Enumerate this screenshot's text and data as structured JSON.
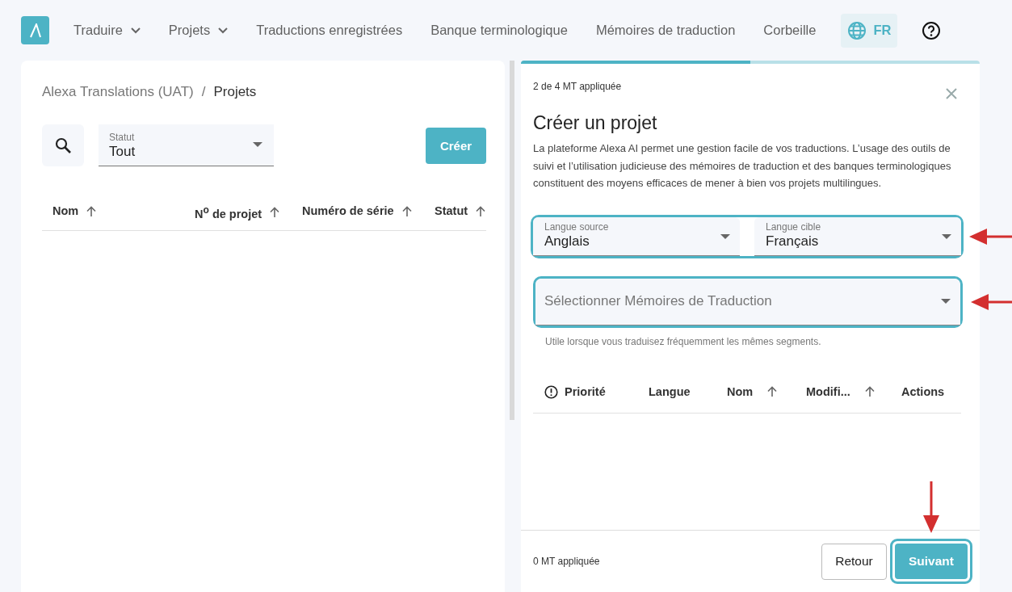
{
  "nav": {
    "items": [
      {
        "label": "Traduire",
        "dropdown": true
      },
      {
        "label": "Projets",
        "dropdown": true
      },
      {
        "label": "Traductions enregistrées",
        "dropdown": false
      },
      {
        "label": "Banque terminologique",
        "dropdown": false
      },
      {
        "label": "Mémoires de traduction",
        "dropdown": false
      },
      {
        "label": "Corbeille",
        "dropdown": false
      }
    ],
    "language": "FR"
  },
  "projects": {
    "breadcrumb": [
      {
        "label": "Alexa Translations (UAT)",
        "current": false
      },
      {
        "label": "Projets",
        "current": true
      }
    ],
    "separator": "/",
    "status_filter": {
      "label": "Statut",
      "value": "Tout"
    },
    "create_button": "Créer",
    "columns": [
      {
        "label": "Nom",
        "sortable": true
      },
      {
        "label": "N$^{o}$ de projet",
        "sortable": true
      },
      {
        "label": "Numéro de série",
        "sortable": true
      },
      {
        "label": "Statut",
        "sortable": true
      }
    ]
  },
  "create_panel": {
    "progress": {
      "level": 0.5
    },
    "step": "2 de 4 MT appliquée",
    "title": "Créer un projet",
    "description": "La plateforme Alexa AI permet une gestion facile de vos traductions. L’usage des outils de suivi et l’utilisation judicieuse des mémoires de traduction et des banques terminologiques constituent des moyens efficaces de mener à bien vos projets multilingues.",
    "source_language": {
      "label": "Langue source",
      "value": "Anglais"
    },
    "target_language": {
      "label": "Langue cible",
      "value": "Français"
    },
    "languages_highlighted": true,
    "memory_select": {
      "placeholder": "Sélectionner Mémoires de Traduction",
      "helper": "Utile lorsque vous traduisez fréquemment les mêmes segments.",
      "highlighted": true
    },
    "memory_columns": [
      {
        "label": "Priorité",
        "sortable": false,
        "alert_icon": true
      },
      {
        "label": "Langue",
        "sortable": false,
        "alert_icon": false
      },
      {
        "label": "Nom",
        "sortable": true,
        "alert_icon": false
      },
      {
        "label": "Modifi...",
        "sortable": true,
        "alert_icon": false
      },
      {
        "label": "Actions",
        "sortable": false,
        "alert_icon": false
      }
    ],
    "footer": {
      "applied": "0 MT appliquée",
      "back_button": "Retour",
      "next_button": "Suivant",
      "next_highlighted": true
    }
  }
}
